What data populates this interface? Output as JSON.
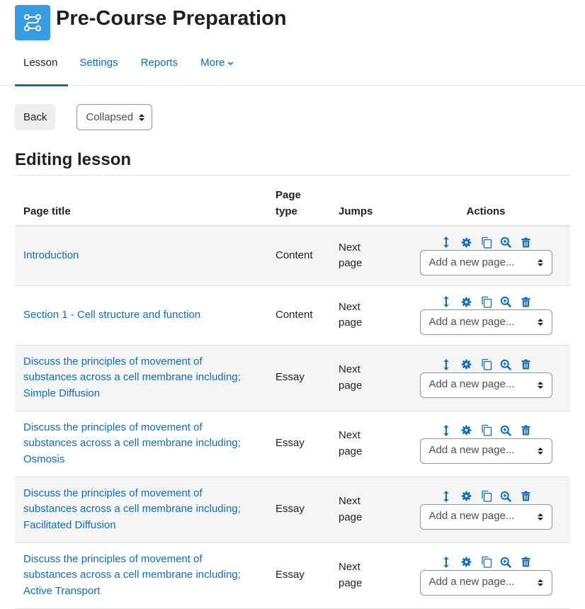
{
  "header": {
    "title": "Pre-Course Preparation",
    "icon": "lesson-icon",
    "icon_color": "#399be2"
  },
  "tabs": [
    {
      "label": "Lesson",
      "active": true
    },
    {
      "label": "Settings",
      "active": false
    },
    {
      "label": "Reports",
      "active": false
    },
    {
      "label": "More",
      "active": false
    }
  ],
  "toolbar": {
    "back_label": "Back",
    "view_select_value": "Collapsed"
  },
  "section_heading": "Editing lesson",
  "table": {
    "headers": {
      "title": "Page title",
      "type": "Page type",
      "jumps": "Jumps",
      "actions": "Actions"
    },
    "action_icons": [
      "move-icon",
      "settings-gear-icon",
      "duplicate-icon",
      "preview-zoom-icon",
      "delete-trash-icon"
    ],
    "add_page_placeholder": "Add a new page...",
    "rows": [
      {
        "title": "Introduction",
        "type": "Content",
        "jumps": "Next page"
      },
      {
        "title": "Section 1 - Cell structure and function",
        "type": "Content",
        "jumps": "Next page"
      },
      {
        "title": "Discuss the principles of movement of substances across a cell membrane including; Simple Diffusion",
        "type": "Essay",
        "jumps": "Next page"
      },
      {
        "title": "Discuss the principles of movement of substances across a cell membrane including; Osmosis",
        "type": "Essay",
        "jumps": "Next page"
      },
      {
        "title": "Discuss the principles of movement of substances across a cell membrane including; Facilitated Diffusion",
        "type": "Essay",
        "jumps": "Next page"
      },
      {
        "title": "Discuss the principles of movement of substances across a cell membrane including; Active Transport",
        "type": "Essay",
        "jumps": "Next page"
      }
    ]
  },
  "colors": {
    "link": "#0f6cbf",
    "text": "#1d2125",
    "row_stripe": "#f5f5f5",
    "border": "#dee2e6"
  }
}
